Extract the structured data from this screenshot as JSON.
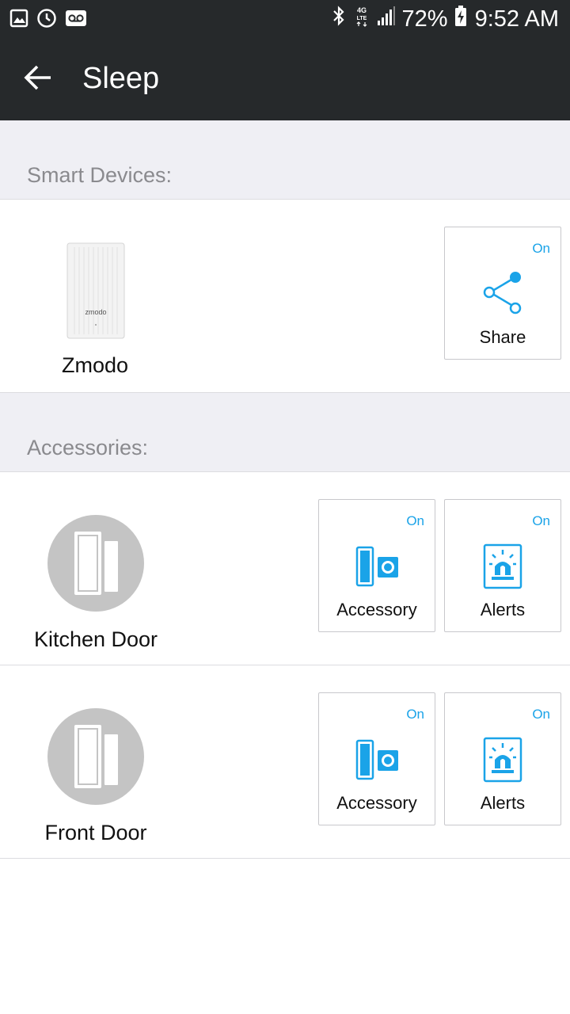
{
  "status_bar": {
    "battery_percent": "72%",
    "time": "9:52 AM",
    "icons": [
      "gallery-icon",
      "sync-icon",
      "voicemail-icon",
      "bluetooth-icon",
      "4g-lte-icon",
      "signal-icon",
      "battery-charging-icon"
    ]
  },
  "app_bar": {
    "title": "Sleep",
    "back_icon": "arrow-left-icon"
  },
  "smart_devices": {
    "heading": "Smart Devices:",
    "items": [
      {
        "name": "Zmodo",
        "image_label": "zmodo",
        "share": {
          "state": "On",
          "label": "Share"
        }
      }
    ]
  },
  "accessories": {
    "heading": "Accessories:",
    "items": [
      {
        "name": "Kitchen Door",
        "accessory": {
          "state": "On",
          "label": "Accessory"
        },
        "alerts": {
          "state": "On",
          "label": "Alerts"
        }
      },
      {
        "name": "Front Door",
        "accessory": {
          "state": "On",
          "label": "Accessory"
        },
        "alerts": {
          "state": "On",
          "label": "Alerts"
        }
      }
    ]
  },
  "colors": {
    "accent": "#1aa3e8",
    "bar": "#26292b",
    "section_bg": "#efeff4"
  }
}
